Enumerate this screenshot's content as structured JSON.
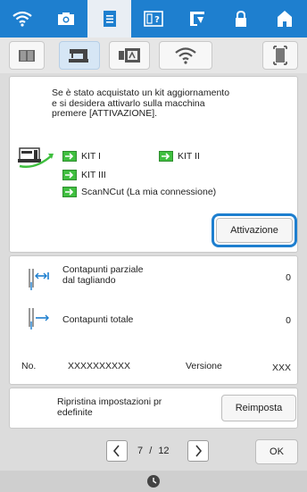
{
  "top_tabs": [
    {
      "icon": "wifi-icon"
    },
    {
      "icon": "camera-icon"
    },
    {
      "icon": "settings-page-icon"
    },
    {
      "icon": "help-icon"
    },
    {
      "icon": "thread-icon"
    },
    {
      "icon": "lock-icon"
    },
    {
      "icon": "home-icon"
    }
  ],
  "sub_tabs": [
    {
      "icon": "book-icon"
    },
    {
      "icon": "sewing-machine-icon"
    },
    {
      "icon": "embroidery-frame-icon"
    },
    {
      "icon": "wifi-icon"
    },
    {
      "icon": "screen-icon"
    }
  ],
  "upgrade": {
    "message_line1": "Se è stato acquistato un kit aggiornamento",
    "message_line2": "e si desidera attivarlo sulla macchina",
    "message_line3": "premere [ATTIVAZIONE].",
    "kits": [
      "KIT I",
      "KIT II",
      "KIT III",
      "ScanNCut (La mia connessione)"
    ],
    "activate_label": "Attivazione"
  },
  "counters": {
    "partial_label_line1": "Contapunti parziale",
    "partial_label_line2": "dal tagliando",
    "partial_value": "0",
    "total_label": "Contapunti totale",
    "total_value": "0",
    "no_label": "No.",
    "no_value": "XXXXXXXXXX",
    "version_label": "Versione",
    "version_value": "XXX"
  },
  "reset": {
    "label_line1": "Ripristina impostazioni pr",
    "label_line2": "edefinite",
    "button_label": "Reimposta"
  },
  "pager": {
    "current": "7",
    "separator": "/",
    "total": "12",
    "ok_label": "OK"
  },
  "colors": {
    "accent": "#1e7fcf",
    "kit_arrow": "#3fbf3f"
  }
}
